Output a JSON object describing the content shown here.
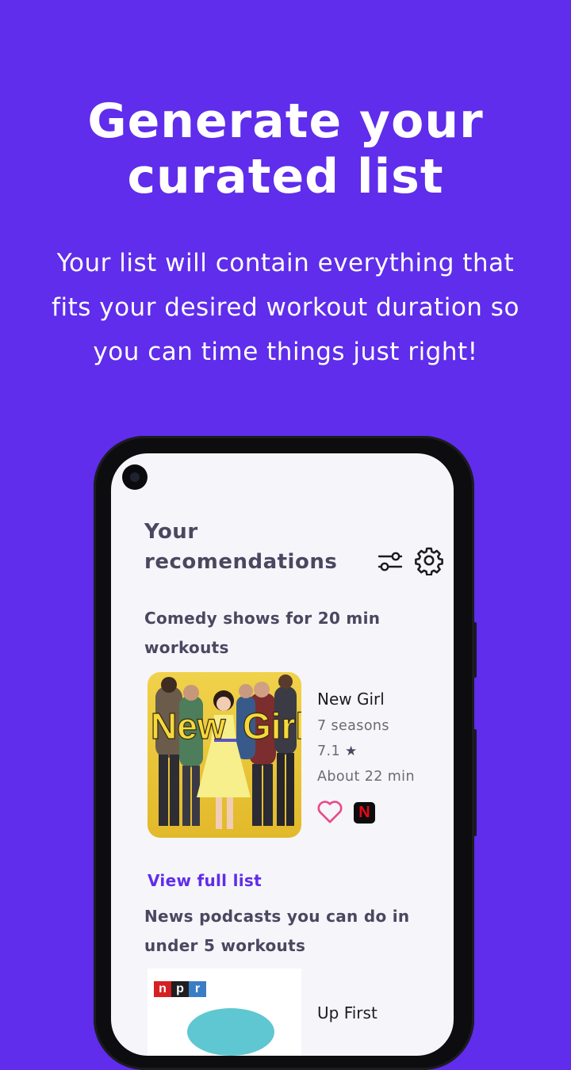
{
  "hero": {
    "headline_line1": "Generate your",
    "headline_line2": "curated list",
    "subtext_line1": "Your list will contain everything that",
    "subtext_line2": "fits your desired workout duration so",
    "subtext_line3": "you can time things just right!"
  },
  "colors": {
    "background": "#5f2deb",
    "accent": "#5f2deb",
    "heart": "#e84a8a",
    "netflix": "#e50914"
  },
  "app": {
    "title_line1": "Your",
    "title_line2": "recomendations",
    "filter_icon": "sliders-icon",
    "settings_icon": "gear-icon"
  },
  "sections": [
    {
      "title_line1": "Comedy shows for 20 min",
      "title_line2": "workouts",
      "item": {
        "poster_text_left": "New",
        "poster_text_right": "Girl",
        "title": "New Girl",
        "seasons": "7 seasons",
        "rating": "7.1",
        "duration": "About 22 min",
        "provider_logo": "N"
      },
      "link": "View full list"
    },
    {
      "title_line1": "News podcasts you can do in",
      "title_line2": "under 5 workouts",
      "item": {
        "logo_letters": [
          "n",
          "p",
          "r"
        ],
        "title": "Up First"
      }
    }
  ]
}
